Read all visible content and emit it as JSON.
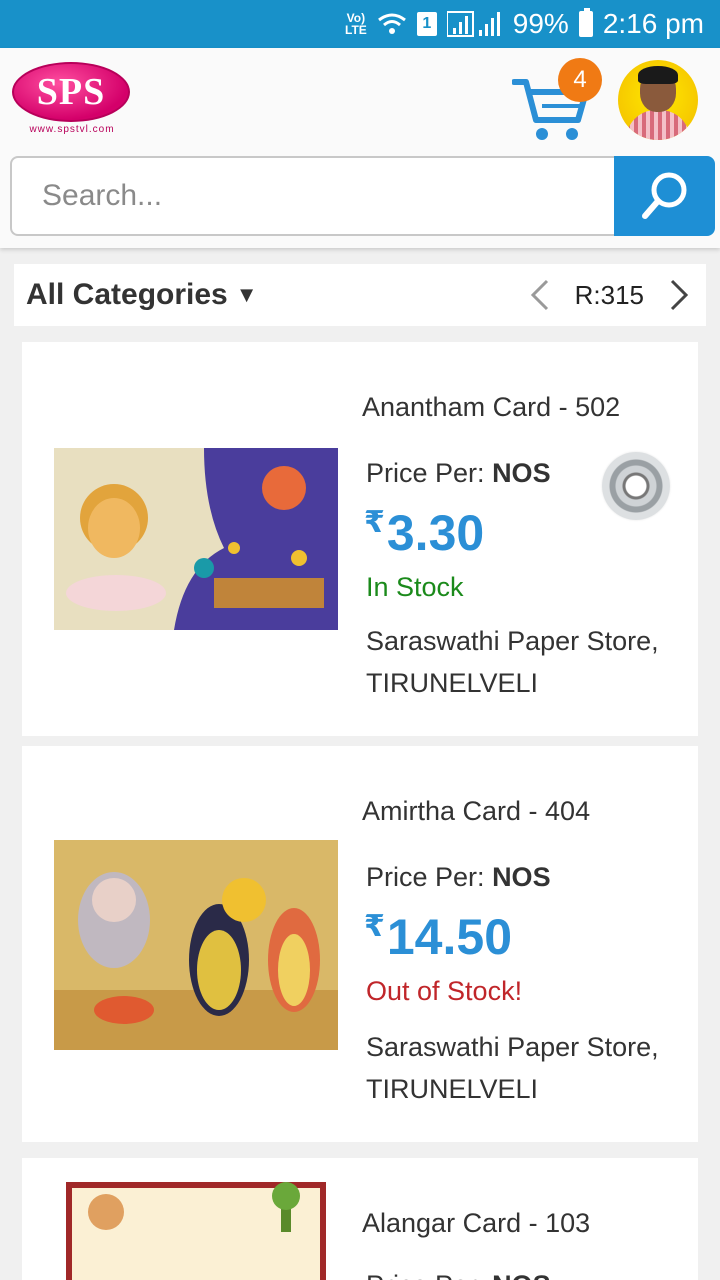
{
  "status_bar": {
    "network": "Vo) LTE",
    "sim": "1",
    "battery": "99%",
    "time": "2:16 pm"
  },
  "header": {
    "logo_text": "SPS",
    "logo_url": "www.spstvl.com",
    "cart_count": "4",
    "search_placeholder": "Search..."
  },
  "category_bar": {
    "label": "All Categories",
    "results": "R:315"
  },
  "products": [
    {
      "title": "Anantham Card - 502",
      "price_per_label": "Price Per:",
      "price_unit": "NOS",
      "currency": "₹",
      "price": "3.30",
      "stock": "In Stock",
      "store": "Saraswathi Paper Store,",
      "city": "TIRUNELVELI"
    },
    {
      "title": "Amirtha Card - 404",
      "price_per_label": "Price Per:",
      "price_unit": "NOS",
      "currency": "₹",
      "price": "14.50",
      "stock": "Out of Stock!",
      "store": "Saraswathi Paper Store,",
      "city": "TIRUNELVELI"
    },
    {
      "title": "Alangar Card - 103",
      "price_per_label": "Price Per:",
      "price_unit": "NOS"
    }
  ],
  "colors": {
    "status_bar": "#1891c9",
    "accent_blue": "#2b8fd6",
    "in_stock": "#1b8a1b",
    "out_of_stock": "#c0262a",
    "badge": "#f07a14"
  }
}
